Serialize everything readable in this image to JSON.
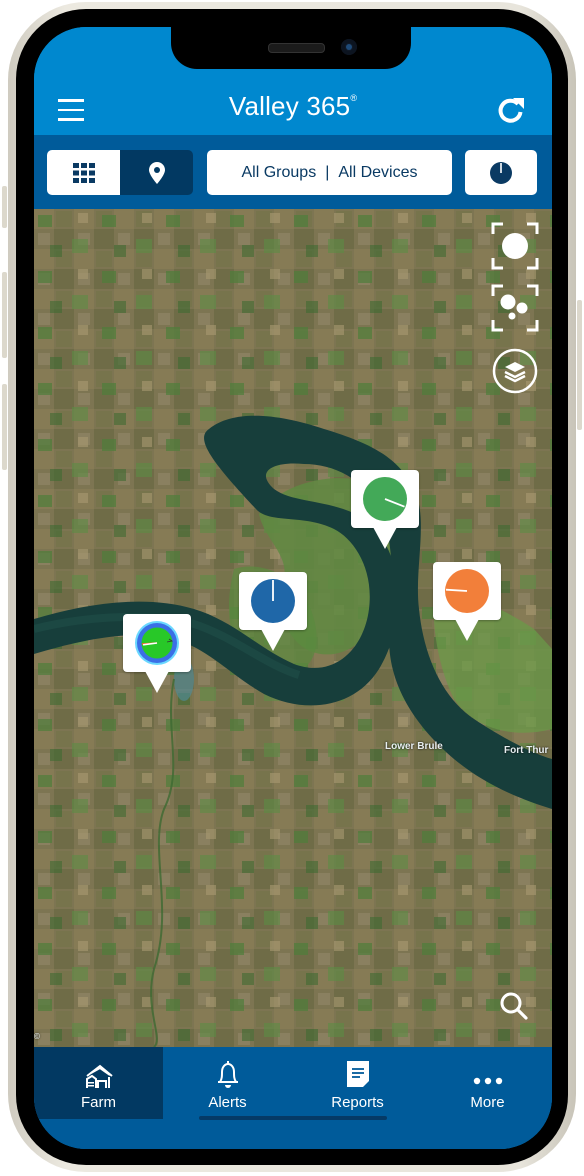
{
  "app": {
    "title": "Valley 365",
    "title_mark": "®"
  },
  "header": {
    "menu_icon": "hamburger-menu-icon",
    "refresh_icon": "refresh-icon"
  },
  "toolbar": {
    "view_toggle": [
      {
        "icon": "grid-view-icon",
        "selected": false
      },
      {
        "icon": "map-pin-icon",
        "selected": true
      }
    ],
    "filter_groups": "All Groups",
    "filter_separator": "|",
    "filter_devices": "All Devices",
    "status_icon": "pie-status-icon"
  },
  "map": {
    "controls": [
      {
        "name": "focus-single-button",
        "icon": "focus-single-icon"
      },
      {
        "name": "focus-all-button",
        "icon": "focus-cluster-icon"
      },
      {
        "name": "layers-button",
        "icon": "layers-icon"
      }
    ],
    "search_icon": "search-icon",
    "place_labels": [
      "Lower Brule",
      "Fort Thur"
    ],
    "attribution": "©",
    "pivots": [
      {
        "status": "running-wet",
        "color": "#28c828",
        "ring_color": "#3b6fe6",
        "position_pct": 73
      },
      {
        "status": "stopped",
        "color": "#1f67a8",
        "position_pct": 0
      },
      {
        "status": "running",
        "color": "#43a958",
        "position_pct": 31
      },
      {
        "status": "warning",
        "color": "#f27f3a",
        "position_pct": 76
      }
    ]
  },
  "tabbar": {
    "tabs": [
      {
        "label": "Farm",
        "icon": "farm-icon",
        "active": true
      },
      {
        "label": "Alerts",
        "icon": "bell-icon",
        "active": false
      },
      {
        "label": "Reports",
        "icon": "report-icon",
        "active": false
      },
      {
        "label": "More",
        "icon": "more-dots-icon",
        "active": false
      }
    ]
  },
  "colors": {
    "header_blue": "#0088cf",
    "toolbar_blue": "#005b9a",
    "dark_navy": "#023962"
  }
}
